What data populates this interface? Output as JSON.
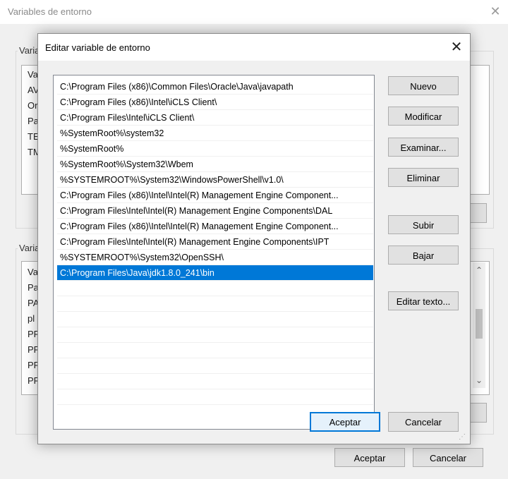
{
  "background_window": {
    "title": "Variables de entorno",
    "user_vars_group_label": "Varia",
    "user_vars_rows": [
      "Va",
      "AV",
      "Or",
      "Pa",
      "TE",
      "TM"
    ],
    "system_vars_group_label": "Varia",
    "system_vars_rows": [
      "Va",
      "Pa",
      "PA",
      "pl",
      "PR",
      "PF",
      "PR",
      "PR"
    ],
    "accept_label": "Aceptar",
    "cancel_label": "Cancelar"
  },
  "dialog": {
    "title": "Editar variable de entorno",
    "paths": [
      "C:\\Program Files (x86)\\Common Files\\Oracle\\Java\\javapath",
      "C:\\Program Files (x86)\\Intel\\iCLS Client\\",
      "C:\\Program Files\\Intel\\iCLS Client\\",
      "%SystemRoot%\\system32",
      "%SystemRoot%",
      "%SystemRoot%\\System32\\Wbem",
      "%SYSTEMROOT%\\System32\\WindowsPowerShell\\v1.0\\",
      "C:\\Program Files (x86)\\Intel\\Intel(R) Management Engine Component...",
      "C:\\Program Files\\Intel\\Intel(R) Management Engine Components\\DAL",
      "C:\\Program Files (x86)\\Intel\\Intel(R) Management Engine Component...",
      "C:\\Program Files\\Intel\\Intel(R) Management Engine Components\\IPT",
      "%SYSTEMROOT%\\System32\\OpenSSH\\",
      "C:\\Program Files\\Java\\jdk1.8.0_241\\bin"
    ],
    "selected_path": "C:\\Program Files\\Java\\jdk1.8.0_241\\bin",
    "buttons": {
      "new": "Nuevo",
      "edit": "Modificar",
      "browse": "Examinar...",
      "delete": "Eliminar",
      "move_up": "Subir",
      "move_down": "Bajar",
      "edit_text": "Editar texto...",
      "accept": "Aceptar",
      "cancel": "Cancelar"
    }
  },
  "colors": {
    "selection": "#0078d7",
    "dialog_bg": "#f0f0f0",
    "button_bg": "#e1e1e1"
  },
  "icons": {
    "close": "close-icon",
    "resize_grip": "resize-grip-icon",
    "scroll_up": "chevron-up-icon",
    "scroll_down": "chevron-down-icon"
  }
}
